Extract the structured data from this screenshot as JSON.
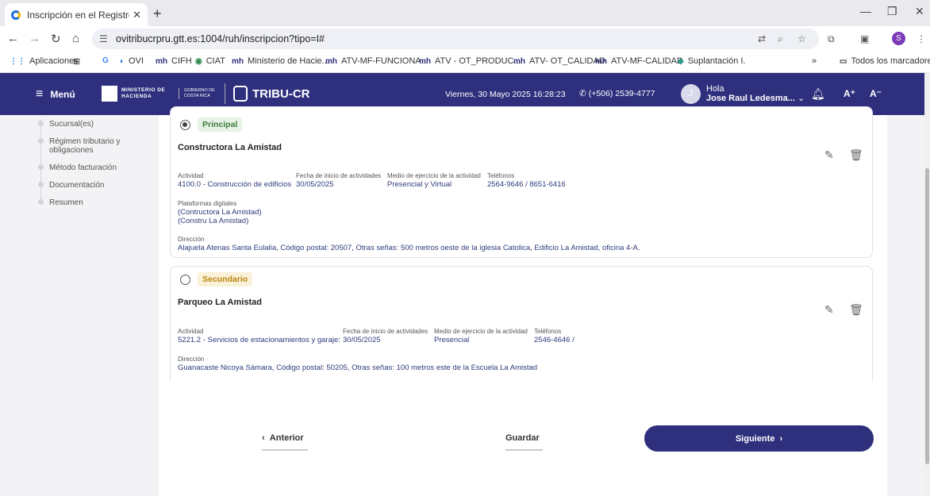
{
  "browser": {
    "tab_title": "Inscripción en el Registro Únicc",
    "url": "ovitribucrpru.gtt.es:1004/ruh/inscripcion?tipo=I#",
    "profile_initial": "S",
    "bookmarks": [
      "Aplicaciones",
      "OVI",
      "CIFH",
      "CIAT",
      "Ministerio de Hacie...",
      "ATV-MF-FUNCIONA...",
      "ATV - OT_PRODUC...",
      "ATV- OT_CALIDAD",
      "ATV-MF-CALIDAD",
      "Suplantación I."
    ],
    "all_bookmarks": "Todos los marcadores"
  },
  "header": {
    "menu_label": "Menú",
    "ministerio": "MINISTERIO DE HACIENDA",
    "gobierno": "GOBIERNO DE COSTA RICA",
    "app_name": "TRIBU-CR",
    "datetime": "Viernes, 30 Mayo 2025 16:28:23",
    "phone": "(+506) 2539-4777",
    "greeting": "Hola",
    "user_name": "Jose Raul Ledesma...",
    "user_initial": "J",
    "font_up": "A⁺",
    "font_down": "A⁻"
  },
  "sidebar": {
    "steps": [
      "Sucursal(es)",
      "Régimen tributario y obligaciones",
      "Método facturación",
      "Documentación",
      "Resumen"
    ]
  },
  "labels": {
    "actividad": "Actividad",
    "fecha": "Fecha de inicio de actividades",
    "medio": "Medio de ejercicio de la actividad",
    "telefonos": "Teléfonos",
    "plataformas": "Plataformas digitales",
    "direccion": "Dirección"
  },
  "branches": [
    {
      "badge": "Principal",
      "selected": true,
      "name": "Constructora La Amistad",
      "actividad": "4100.0 - Construcción de edificios",
      "fecha": "30/05/2025",
      "medio": "Presencial y Virtual",
      "telefonos": "2564-9646 / 8651-6416",
      "plataformas": [
        "(Contructora La Amistad)",
        "(Constru La Amistad)"
      ],
      "direccion": "Alajuela Atenas Santa Eulalia, Código postal: 20507, Otras señas: 500 metros oeste de la iglesia Catolica, Edificio La Amistad, oficina 4-A."
    },
    {
      "badge": "Secundario",
      "selected": false,
      "name": "Parqueo La Amistad",
      "actividad": "5221.2 - Servicios de estacionamientos y garaje:",
      "fecha": "30/05/2025",
      "medio": "Presencial",
      "telefonos": "2546-4646 /",
      "direccion": "Guanacaste Nicoya Sámara, Código postal: 50205, Otras señas: 100 metros este de la Escuela La Amistad"
    }
  ],
  "actions": {
    "prev": "Anterior",
    "save": "Guardar",
    "next": "Siguiente"
  },
  "colors": {
    "brand": "#2e2f7d"
  }
}
